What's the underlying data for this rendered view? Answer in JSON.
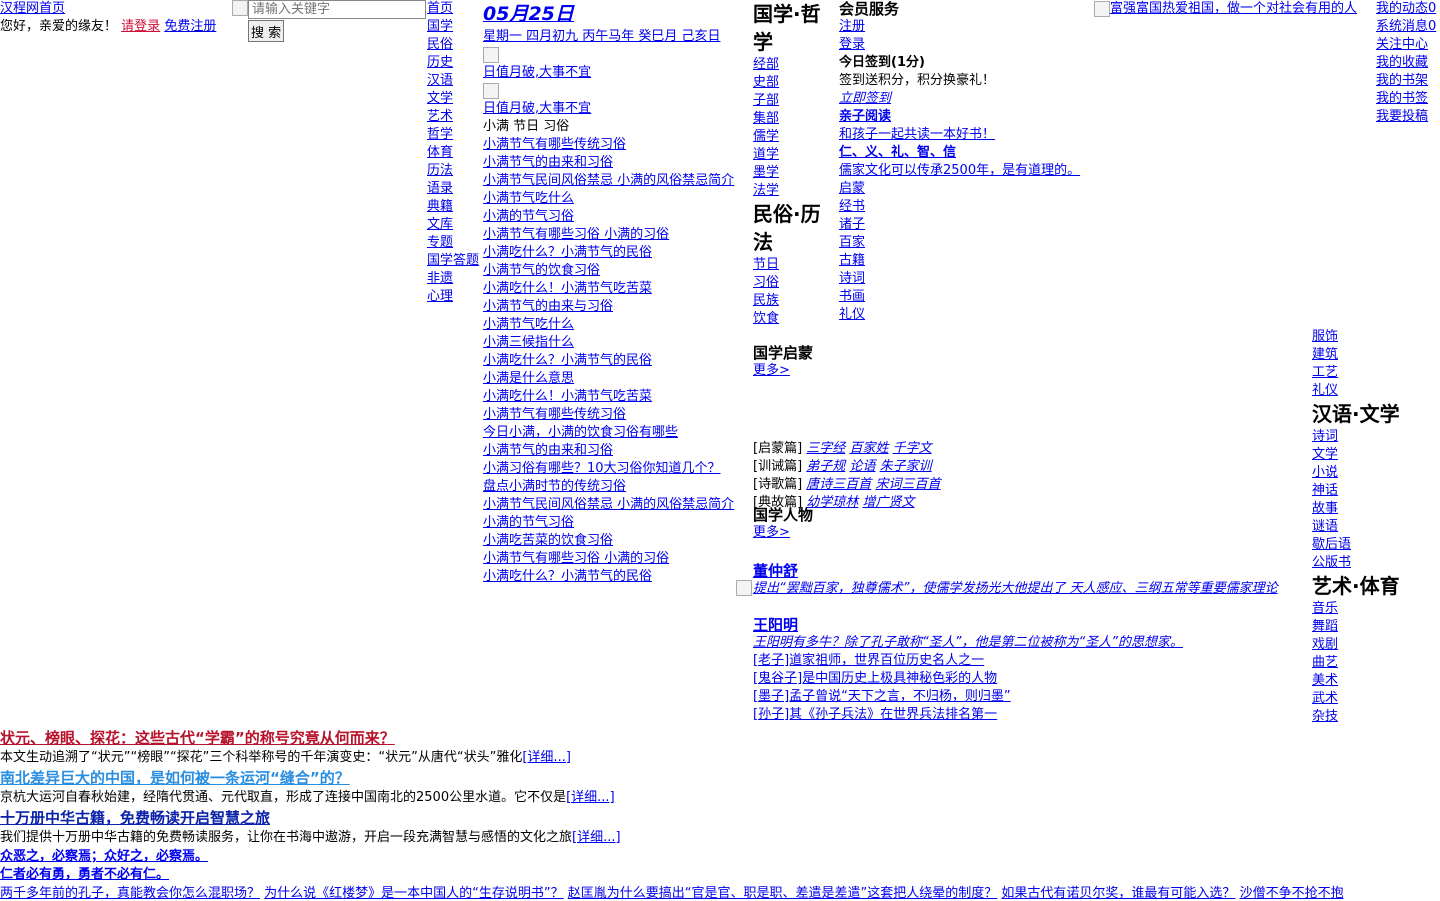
{
  "site": {
    "home": "汉程网首页",
    "greeting": "您好，亲爱的缘友！",
    "login": "请登录",
    "register": "免费注册"
  },
  "search": {
    "placeholder": "请输入关键字",
    "button": "搜 索"
  },
  "nav": [
    "首页",
    "国学",
    "民俗",
    "历史",
    "汉语",
    "文学",
    "艺术",
    "哲学",
    "体育",
    "历法",
    "语录",
    "典籍",
    "文库",
    "专题",
    "国学答题",
    "非遗",
    "心理"
  ],
  "calendar": {
    "date": "05月25日",
    "lunar": "星期一 四月初九 丙午马年 癸巳月 己亥日",
    "yi": "日值月破,大事不宜",
    "ji": "日值月破,大事不宜",
    "festival": "小满 节日 习俗",
    "links": [
      "小满节气有哪些传统习俗",
      "小满节气的由来和习俗",
      "小满节气民间风俗禁忌 小满的风俗禁忌简介",
      "小满节气吃什么",
      "小满的节气习俗",
      "小满节气有哪些习俗 小满的习俗",
      "小满吃什么？小满节气的民俗",
      "小满节气的饮食习俗",
      "小满吃什么！小满节气吃苦菜",
      "小满节气的由来与习俗",
      "小满节气吃什么",
      "小满三候指什么",
      "小满吃什么？小满节气的民俗",
      "小满是什么意思",
      "小满吃什么！小满节气吃苦菜",
      "小满节气有哪些传统习俗",
      "今日小满，小满的饮食习俗有哪些",
      "小满节气的由来和习俗",
      "小满习俗有哪些？10大习俗你知道几个？",
      "盘点小满时节的传统习俗",
      "小满节气民间风俗禁忌 小满的风俗禁忌简介",
      "小满的节气习俗",
      "小满吃苦菜的饮食习俗",
      "小满节气有哪些习俗 小满的习俗",
      "小满吃什么？小满节气的民俗"
    ]
  },
  "categories": {
    "philosophy_title": "国学·哲学",
    "philosophy": [
      "经部",
      "史部",
      "子部",
      "集部",
      "儒学",
      "道学",
      "墨学",
      "法学"
    ],
    "folk_title": "民俗·历法",
    "folk": [
      "节日",
      "习俗",
      "民族",
      "饮食"
    ]
  },
  "member": {
    "title": "会员服务",
    "register": "注册",
    "login": "登录",
    "checkin_title": "今日签到(1分)",
    "checkin_desc": "签到送积分，积分换豪礼！",
    "checkin_link": "立即签到",
    "parent_title": "亲子阅读",
    "parent_link": "和孩子一起共读一本好书！",
    "virtues_title": "仁、义、礼、智、信",
    "virtues_link": "儒家文化可以传承2500年，是有道理的。",
    "more_cats": [
      "启蒙",
      "经书",
      "诸子",
      "百家",
      "古籍",
      "诗词",
      "书画",
      "礼仪"
    ]
  },
  "banner": {
    "alt": "富强富国热爱祖国，做一个对社会有用的人"
  },
  "user_menu": [
    "我的动态0",
    "系统消息0",
    "关注中心",
    "我的收藏",
    "我的书架",
    "我的书签",
    "我要投稿"
  ],
  "right_categories": {
    "top": [
      "服饰",
      "建筑",
      "工艺",
      "礼仪"
    ],
    "lit_title": "汉语·文学",
    "lit": [
      "诗词",
      "文学",
      "小说",
      "神话",
      "故事",
      "谜语",
      "歇后语",
      "公版书"
    ],
    "art_title": "艺术·体育",
    "art": [
      "音乐",
      "舞蹈",
      "戏剧",
      "曲艺",
      "美术",
      "武术",
      "杂技"
    ]
  },
  "qimeng": {
    "title": "国学启蒙",
    "more": "更多>",
    "rows": [
      {
        "label": "[启蒙篇]",
        "links": [
          "三字经",
          "百家姓",
          "千字文"
        ]
      },
      {
        "label": "[训诫篇]",
        "links": [
          "弟子规",
          "论语",
          "朱子家训"
        ]
      },
      {
        "label": "[诗歌篇]",
        "links": [
          "唐诗三百首",
          "宋词三百首"
        ]
      },
      {
        "label": "[典故篇]",
        "links": [
          "幼学琼林",
          "增广贤文"
        ]
      }
    ]
  },
  "figures": {
    "title": "国学人物",
    "more": "更多>",
    "person1": "董仲舒",
    "person1_desc": "提出“罢黜百家，独尊儒术”，使儒学发扬光大他提出了 天人感应、三纲五常等重要儒家理论",
    "person2": "王阳明",
    "person2_desc": "王阳明有多牛？除了孔子敢称“圣人”，他是第二位被称为“圣人”的思想家。",
    "others": [
      "[老子]道家祖师，世界百位历史名人之一",
      "[鬼谷子]是中国历史上极具神秘色彩的人物",
      "[墨子]孟子曾说“天下之言，不归杨，则归墨”",
      "[孙子]其《孙子兵法》在世界兵法排名第一"
    ]
  },
  "articles": [
    {
      "title": "状元、榜眼、探花：这些古代“学霸”的称号究竟从何而来？",
      "desc": "本文生动追溯了“状元”“榜眼”“探花”三个科举称号的千年演变史：“状元”从唐代“状头”雅化",
      "more": "[详细...]"
    },
    {
      "title": "南北差异巨大的中国，是如何被一条运河“缝合”的？",
      "desc": "京杭大运河自春秋始建，经隋代贯通、元代取直，形成了连接中国南北的2500公里水道。它不仅是",
      "more": "[详细...]"
    },
    {
      "title": "十万册中华古籍，免费畅读开启智慧之旅",
      "desc": "我们提供十万册中华古籍的免费畅读服务，让你在书海中遨游，开启一段充满智慧与感悟的文化之旅",
      "more": "[详细...]"
    }
  ],
  "quotes": [
    "众恶之，必察焉；众好之，必察焉。",
    "仁者必有勇，勇者不必有仁。"
  ],
  "bottom_links": [
    "两千多年前的孔子，真能教会你怎么混职场？",
    "为什么说《红楼梦》是一本中国人的“生存说明书”？",
    "赵匡胤为什么要搞出“官是官、职是职、差遣是差遣”这套把人绕晕的制度？",
    "如果古代有诺贝尔奖，谁最有可能入选？",
    "沙僧不争不抢不抱"
  ]
}
